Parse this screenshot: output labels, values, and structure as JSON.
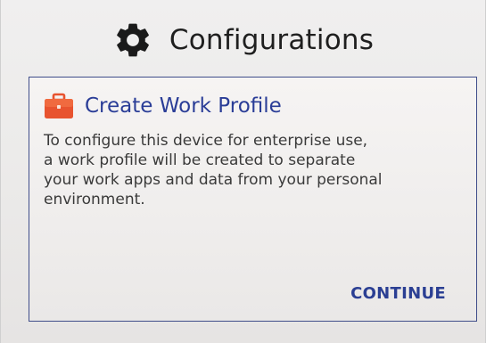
{
  "header": {
    "icon": "gear-icon",
    "title": "Configurations"
  },
  "card": {
    "icon": "briefcase-icon",
    "title": "Create Work Profile",
    "body_lines": [
      "To configure this device for enterprise use,",
      "a work profile will be created to separate",
      "your work apps and data from your personal",
      "environment."
    ],
    "continue_label": "CONTINUE"
  },
  "colors": {
    "accent": "#2a3d97",
    "briefcase": "#e8532f",
    "card_border": "#3f4d8a",
    "title_text": "#1f1f1f",
    "body_text": "#3a3a3a"
  }
}
